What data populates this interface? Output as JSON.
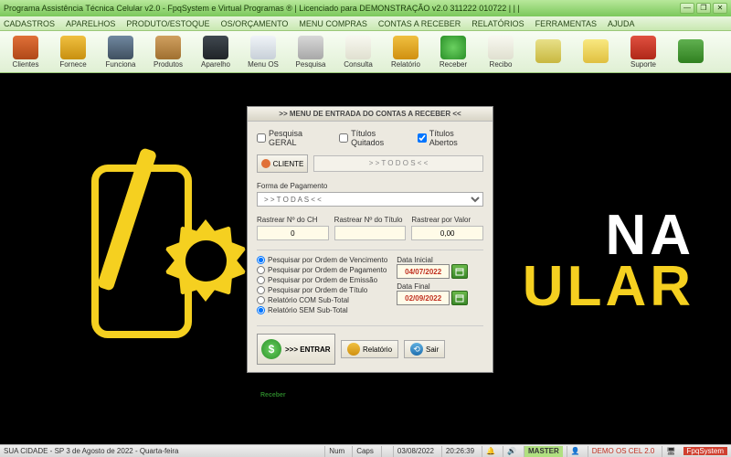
{
  "titlebar": {
    "text": "Programa Assistência Técnica Celular v2.0 - FpqSystem e Virtual Programas ® | Licenciado para  DEMONSTRAÇÃO v2.0 311222 010722 | | |"
  },
  "menubar": [
    "CADASTROS",
    "APARELHOS",
    "PRODUTO/ESTOQUE",
    "OS/ORÇAMENTO",
    "MENU COMPRAS",
    "CONTAS A RECEBER",
    "RELATÓRIOS",
    "FERRAMENTAS",
    "AJUDA"
  ],
  "toolbar": [
    {
      "name": "clientes",
      "label": "Clientes",
      "color": "linear-gradient(#e07038,#b04818)"
    },
    {
      "name": "fornec",
      "label": "Fornece",
      "color": "linear-gradient(#f0c040,#c89010)"
    },
    {
      "name": "funciona",
      "label": "Funciona",
      "color": "linear-gradient(#7088a0,#405060)"
    },
    {
      "name": "produtos",
      "label": "Produtos",
      "color": "linear-gradient(#d0a060,#a07030)"
    },
    {
      "name": "aparelho",
      "label": "Aparelho",
      "color": "linear-gradient(#404850,#202428)"
    },
    {
      "name": "menu-os",
      "label": "Menu OS",
      "color": "linear-gradient(#f0f4f8,#c8d0d8)"
    },
    {
      "name": "pesquisa",
      "label": "Pesquisa",
      "color": "linear-gradient(#d8d8d8,#a8a8a8)"
    },
    {
      "name": "consulta",
      "label": "Consulta",
      "color": "linear-gradient(#f8f8f0,#e0e0d0)"
    },
    {
      "name": "relatorio",
      "label": "Relatório",
      "color": "linear-gradient(#f0c040,#d09010)"
    },
    {
      "name": "receber",
      "label": "Receber",
      "color": "radial-gradient(circle,#6ad060,#2a9028)"
    },
    {
      "name": "recibo",
      "label": "Recibo",
      "color": "linear-gradient(#f8f8f0,#e0e0d0)"
    },
    {
      "name": "search",
      "label": "",
      "color": "linear-gradient(#e8e088,#c8b840)"
    },
    {
      "name": "calc",
      "label": "",
      "color": "linear-gradient(#f8e880,#e0c040)"
    },
    {
      "name": "suporte",
      "label": "Suporte",
      "color": "linear-gradient(#e05040,#b02818)"
    },
    {
      "name": "export",
      "label": "",
      "color": "linear-gradient(#60b050,#308020)"
    }
  ],
  "logo": {
    "line1": "NA",
    "line2": "ULAR"
  },
  "dialog": {
    "title": ">>  MENU DE ENTRADA DO CONTAS A RECEBER  <<",
    "checks": {
      "geral": "Pesquisa GERAL",
      "quitados": "Títulos Quitados",
      "abertos": "Títulos Abertos"
    },
    "cliente_btn": "CLIENTE",
    "cliente_placeholder": "> > T O D O S < <",
    "forma_label": "Forma de Pagamento",
    "forma_value": "> > T O D A S < <",
    "rastrear": {
      "ch_label": "Rastrear Nº do CH",
      "ch_value": "0",
      "titulo_label": "Rastrear Nº do Título",
      "titulo_value": "",
      "valor_label": "Rastrear por Valor",
      "valor_value": "0,00"
    },
    "radios": {
      "vencimento": "Pesquisar por Ordem de Vencimento",
      "pagamento": "Pesquisar por Ordem de Pagamento",
      "emissao": "Pesquisar por Ordem de Emissão",
      "titulo": "Pesquisar por Ordem de Título",
      "com_sub": "Relatório COM Sub-Total",
      "sem_sub": "Relatório SEM Sub-Total"
    },
    "dates": {
      "inicial_label": "Data Inicial",
      "inicial_value": "04/07/2022",
      "final_label": "Data Final",
      "final_value": "02/09/2022"
    },
    "buttons": {
      "entrar": ">>> ENTRAR",
      "entrar_sub": "Receber",
      "relatorio": "Relatório",
      "sair": "Sair"
    }
  },
  "statusbar": {
    "cidade": "SUA CIDADE - SP  3 de Agosto de 2022 - Quarta-feira",
    "num": "Num",
    "caps": "Caps",
    "data": "03/08/2022",
    "hora": "20:26:39",
    "master": "MASTER",
    "demo": "DEMO OS CEL 2.0",
    "fpq": "FpqSystem"
  }
}
